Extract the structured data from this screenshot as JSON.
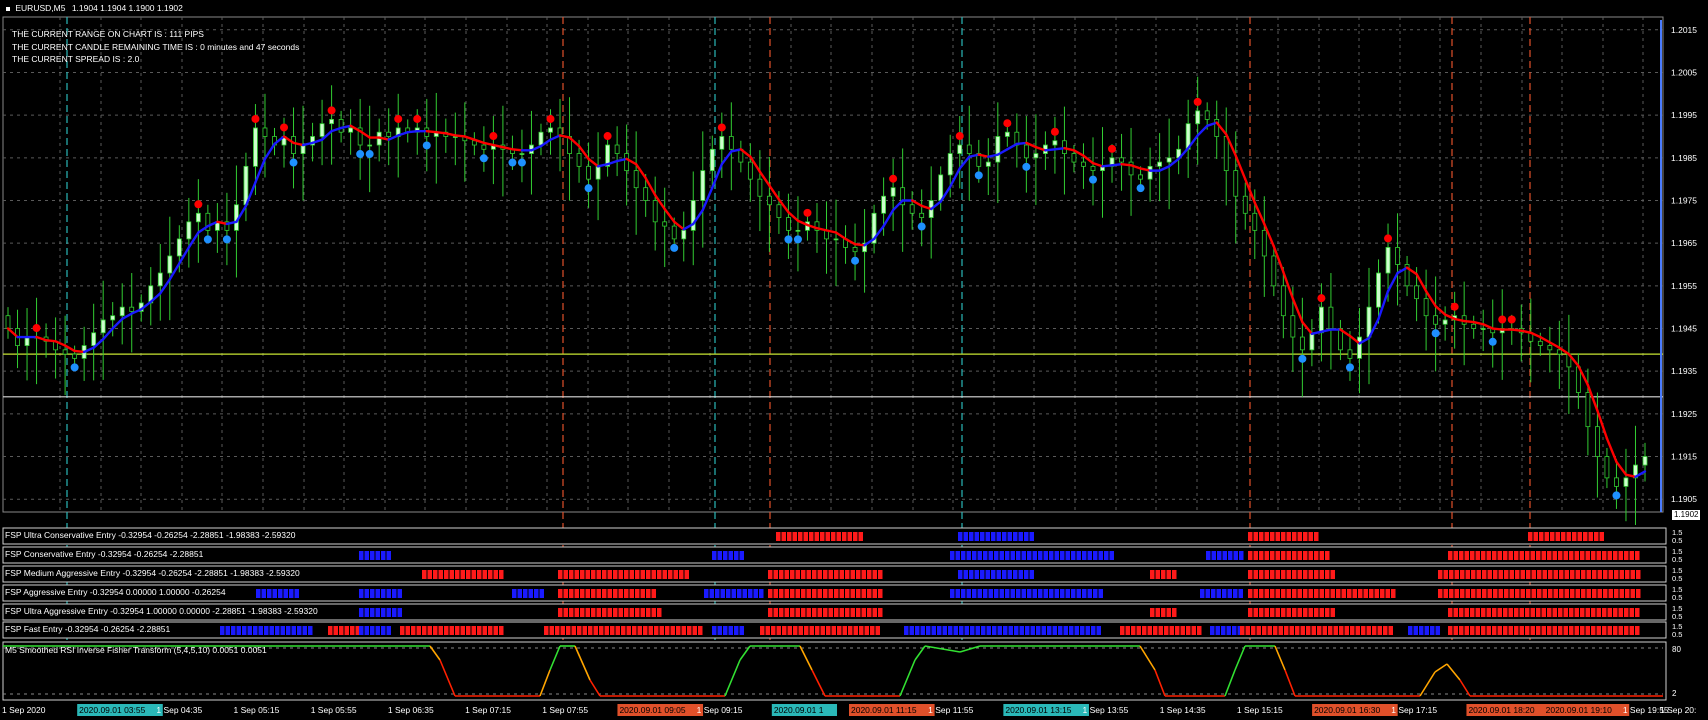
{
  "header": {
    "symbol": "EURUSD,M5",
    "ohlc": "1.1904 1.1904 1.1900 1.1902"
  },
  "info_lines": [
    "THE CURRENT RANGE ON CHART IS : 111 PIPS",
    "THE CURRENT CANDLE REMAINING TIME IS : 0 minutes and 47 seconds",
    "THE CURRENT SPREAD IS : 2.0"
  ],
  "current_price": "1.1902",
  "indicators": [
    {
      "name": "FSP Ultra Conservative Entry",
      "values": "-0.32954 -0.26254 -2.28851 -1.98383 -2.59320"
    },
    {
      "name": "FSP Conservative Entry",
      "values": "-0.32954 -0.26254 -2.28851"
    },
    {
      "name": "FSP Medium Aggressive Entry",
      "values": "-0.32954 -0.26254 -2.28851 -1.98383 -2.59320"
    },
    {
      "name": "FSP Aggressive Entry",
      "values": "-0.32954 0.00000 1.00000 -0.26254"
    },
    {
      "name": "FSP Ultra Aggressive Entry",
      "values": "-0.32954 1.00000 0.00000 -2.28851 -1.98383 -2.59320"
    },
    {
      "name": "FSP Fast Entry",
      "values": "-0.32954 -0.26254 -2.28851"
    }
  ],
  "indicator_scale_labels": [
    "1.5",
    "0.5"
  ],
  "rsi": {
    "title": "M5 Smoothed RSI Inverse Fisher Transform (5,4,5,10) 0.0051 0.0051",
    "levels": [
      "80",
      "2"
    ]
  },
  "time_labels": [
    {
      "text": "1 Sep 2020",
      "hl": null
    },
    {
      "text": "2020.09.01 03:55",
      "hl": "cyan"
    },
    {
      "text": "1 Sep 04:35",
      "hl": null
    },
    {
      "text": "1 Sep 05:15",
      "hl": null
    },
    {
      "text": "1 Sep 05:55",
      "hl": null
    },
    {
      "text": "1 Sep 06:35",
      "hl": null
    },
    {
      "text": "1 Sep 07:15",
      "hl": null
    },
    {
      "text": "1 Sep 07:55",
      "hl": null
    },
    {
      "text": "2020.09.01 09:05",
      "hl": "orange"
    },
    {
      "text": "1 Sep 09:15",
      "hl": null
    },
    {
      "text": "2020.09.01 1",
      "hl": "cyan"
    },
    {
      "text": "2020.09.01 11:15",
      "hl": "orange"
    },
    {
      "text": "1 Sep 11:55",
      "hl": null
    },
    {
      "text": "2020.09.01 13:15",
      "hl": "cyan"
    },
    {
      "text": "1 Sep 13:55",
      "hl": null
    },
    {
      "text": "1 Sep 14:35",
      "hl": null
    },
    {
      "text": "1 Sep 15:15",
      "hl": null
    },
    {
      "text": "2020.09.01 16:30",
      "hl": "orange"
    },
    {
      "text": "1 Sep 17:15",
      "hl": null
    },
    {
      "text": "2020.09.01 18:20",
      "hl": "orange"
    },
    {
      "text": "2020.09.01 19:10",
      "hl": "orange"
    },
    {
      "text": "1 Sep 19:55",
      "hl": null
    },
    {
      "text": "1 Sep 20:",
      "hl": null
    }
  ],
  "colors": {
    "background": "#000000",
    "grid": "#5a5a5a",
    "bull_candle": "#ccffcc",
    "wick": "#32cd32",
    "blue_line": "#1a1aff",
    "red_line": "#ff0000",
    "buy_dot": "#1e90ff",
    "sell_dot": "#ff0000",
    "h_line_yellow": "#c8e632",
    "h_line_white": "#dddddd",
    "vline_cyan": "#2ab8b8",
    "vline_orange": "#e0502a",
    "rsi_green": "#32e032",
    "rsi_orange": "#ffa500",
    "rsi_red": "#ff2000"
  },
  "chart_data": {
    "type": "candlestick",
    "symbol": "EURUSD",
    "timeframe": "M5",
    "ylim": [
      1.1902,
      1.2018
    ],
    "y_ticks": [
      "1.2015",
      "1.2005",
      "1.1995",
      "1.1985",
      "1.1975",
      "1.1965",
      "1.1955",
      "1.1945",
      "1.1935",
      "1.1925",
      "1.1915",
      "1.1905"
    ],
    "closes": [
      1.1945,
      1.1941,
      1.1943,
      1.1943,
      1.1942,
      1.194,
      1.1939,
      1.1938,
      1.1941,
      1.1944,
      1.1947,
      1.1948,
      1.195,
      1.1949,
      1.1951,
      1.1955,
      1.1958,
      1.1962,
      1.1966,
      1.197,
      1.1972,
      1.1968,
      1.197,
      1.1968,
      1.1974,
      1.1983,
      1.1992,
      1.199,
      1.1988,
      1.199,
      1.1986,
      1.1988,
      1.199,
      1.1993,
      1.1994,
      1.1991,
      1.1992,
      1.1988,
      1.1988,
      1.1991,
      1.199,
      1.1992,
      1.1991,
      1.1992,
      1.199,
      1.1991,
      1.199,
      1.199,
      1.1989,
      1.1988,
      1.1987,
      1.1988,
      1.1987,
      1.1986,
      1.1986,
      1.1988,
      1.1991,
      1.1992,
      1.199,
      1.1986,
      1.1983,
      1.198,
      1.1983,
      1.1988,
      1.1986,
      1.1982,
      1.1978,
      1.1975,
      1.197,
      1.1969,
      1.1966,
      1.1968,
      1.1975,
      1.1982,
      1.1987,
      1.199,
      1.1987,
      1.1984,
      1.198,
      1.1976,
      1.1974,
      1.1971,
      1.1968,
      1.1968,
      1.197,
      1.1968,
      1.1966,
      1.1966,
      1.1964,
      1.1963,
      1.1965,
      1.1972,
      1.1976,
      1.1978,
      1.1974,
      1.1972,
      1.1971,
      1.1975,
      1.1981,
      1.1986,
      1.1988,
      1.1986,
      1.1983,
      1.1984,
      1.199,
      1.1991,
      1.1988,
      1.1985,
      1.1986,
      1.1988,
      1.1989,
      1.1986,
      1.1984,
      1.1983,
      1.1982,
      1.1983,
      1.1985,
      1.1984,
      1.1981,
      1.198,
      1.1983,
      1.1984,
      1.1985,
      1.1987,
      1.1993,
      1.1996,
      1.1994,
      1.199,
      1.1982,
      1.1976,
      1.1972,
      1.1968,
      1.1962,
      1.1955,
      1.1948,
      1.1943,
      1.194,
      1.1944,
      1.195,
      1.1945,
      1.194,
      1.1938,
      1.1943,
      1.195,
      1.1958,
      1.1964,
      1.196,
      1.1955,
      1.1952,
      1.1948,
      1.1946,
      1.1947,
      1.1948,
      1.1946,
      1.1945,
      1.1945,
      1.1944,
      1.1945,
      1.1945,
      1.1944,
      1.1942,
      1.1941,
      1.194,
      1.1939,
      1.1936,
      1.193,
      1.1922,
      1.1915,
      1.191,
      1.1908,
      1.191,
      1.1913,
      1.1915
    ],
    "series": [
      {
        "name": "blue_line",
        "color": "#1a1aff"
      },
      {
        "name": "red_line",
        "color": "#ff0000"
      }
    ],
    "horizontal_lines": [
      1.1939,
      1.1929
    ],
    "current_price": 1.1902
  }
}
